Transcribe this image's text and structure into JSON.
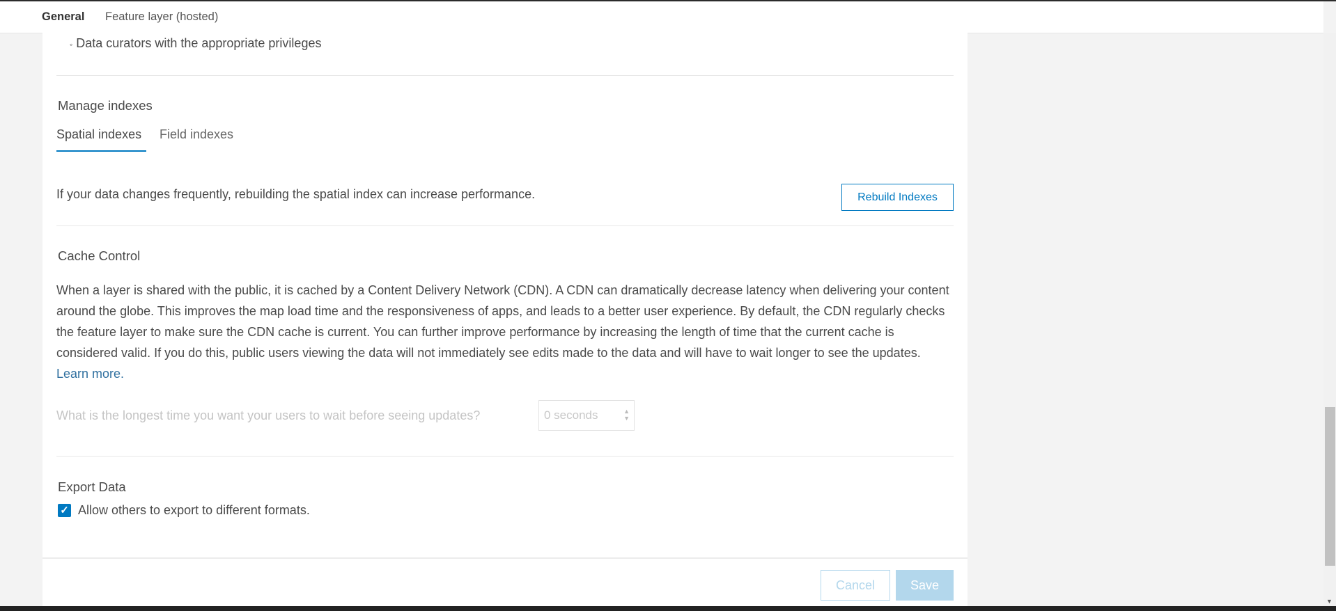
{
  "header": {
    "tabs": [
      {
        "label": "General",
        "active": true
      },
      {
        "label": "Feature layer (hosted)",
        "active": false
      }
    ]
  },
  "bullet": {
    "marker": "◦",
    "text": "Data curators with the appropriate privileges"
  },
  "manage_indexes": {
    "title": "Manage indexes",
    "tabs": [
      {
        "label": "Spatial indexes",
        "active": true
      },
      {
        "label": "Field indexes",
        "active": false
      }
    ],
    "description": "If your data changes frequently, rebuilding the spatial index can increase performance.",
    "rebuild_label": "Rebuild Indexes"
  },
  "cache_control": {
    "title": "Cache Control",
    "description": "When a layer is shared with the public, it is cached by a Content Delivery Network (CDN). A CDN can dramatically decrease latency when delivering your content around the globe. This improves the map load time and the responsiveness of apps, and leads to a better user experience. By default, the CDN regularly checks the feature layer to make sure the CDN cache is current. You can further improve performance by increasing the length of time that the current cache is considered valid. If you do this, public users viewing the data will not immediately see edits made to the data and will have to wait longer to see the updates.",
    "learn_more": "Learn more.",
    "question": "What is the longest time you want your users to wait before seeing updates?",
    "select_value": "0 seconds"
  },
  "export_data": {
    "title": "Export Data",
    "checkbox_label": "Allow others to export to different formats.",
    "checked": true
  },
  "footer": {
    "cancel_label": "Cancel",
    "save_label": "Save"
  },
  "colors": {
    "accent": "#0079c1",
    "disabled_accent": "#b3d7ec"
  }
}
